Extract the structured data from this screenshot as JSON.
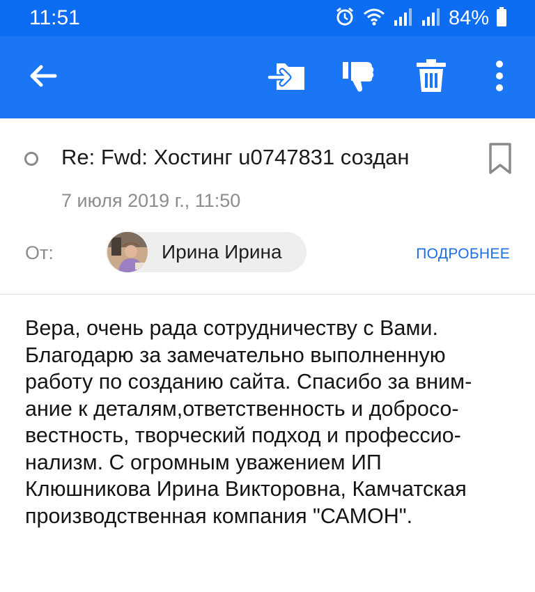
{
  "status_bar": {
    "time": "11:51",
    "battery_percent": "84%",
    "icons": [
      "alarm-icon",
      "wifi-icon",
      "signal-icon",
      "signal-icon",
      "battery-icon"
    ]
  },
  "app_bar": {
    "color": "#1a76f5",
    "actions": [
      "back-icon",
      "move-to-folder-icon",
      "dislike-icon",
      "trash-icon",
      "more-vertical-icon"
    ]
  },
  "message": {
    "subject": "Re: Fwd: Хостинг u0747831 создан",
    "date": "7 июля 2019 г., 11:50",
    "from_label": "От:",
    "sender_name": "Ирина Ирина",
    "details_link": "ПОДРОБНЕЕ",
    "body_lines": [
      "Вера, очень рада сотрудничеству с Вами.",
      "Благодарю за замечательно выполненную",
      "работу по созданию сайта. Спасибо за вним-",
      "ание к деталям,ответственность и добросо-",
      "вестность, творческий подход и профессио-",
      "нализм. С огромным уважением ИП",
      "Клюшникова Ирина Викторовна, Камчатская",
      "производственная компания \"САМОН\"."
    ]
  }
}
